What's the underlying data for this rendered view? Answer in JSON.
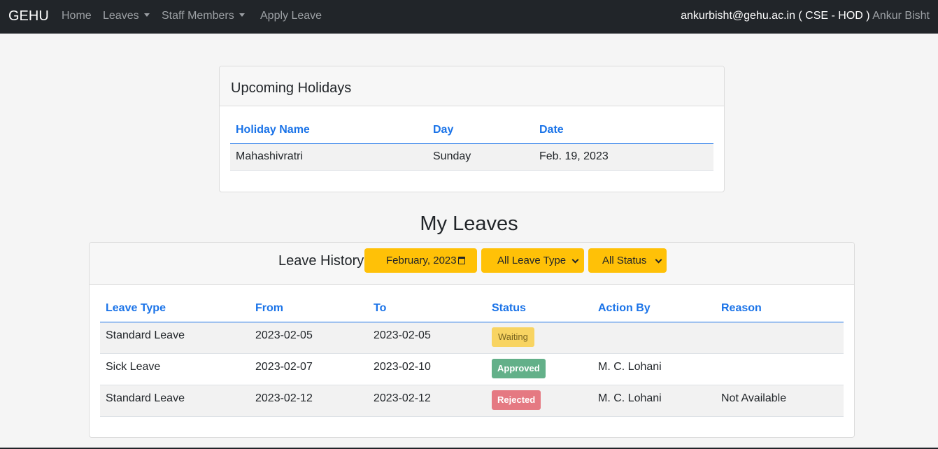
{
  "nav": {
    "brand": "GEHU",
    "items": [
      {
        "label": "Home"
      },
      {
        "label": "Leaves"
      },
      {
        "label": "Staff Members"
      },
      {
        "label": "Apply Leave"
      }
    ],
    "user_email_role": "ankurbisht@gehu.ac.in ( CSE - HOD )",
    "user_name": "Ankur Bisht"
  },
  "holidays": {
    "title": "Upcoming Holidays",
    "columns": [
      "Holiday Name",
      "Day",
      "Date"
    ],
    "rows": [
      {
        "name": "Mahashivratri",
        "day": "Sunday",
        "date": "Feb. 19, 2023"
      }
    ]
  },
  "leaves": {
    "section_title": "My Leaves",
    "header_label": "Leave History",
    "filters": {
      "month": "February, 2023",
      "type": "All Leave Type",
      "status": "All Status"
    },
    "columns": [
      "Leave Type",
      "From",
      "To",
      "Status",
      "Action By",
      "Reason"
    ],
    "rows": [
      {
        "type": "Standard Leave",
        "from": "2023-02-05",
        "to": "2023-02-05",
        "status": "Waiting",
        "action_by": "",
        "reason": ""
      },
      {
        "type": "Sick Leave",
        "from": "2023-02-07",
        "to": "2023-02-10",
        "status": "Approved",
        "action_by": "M. C. Lohani",
        "reason": ""
      },
      {
        "type": "Standard Leave",
        "from": "2023-02-12",
        "to": "2023-02-12",
        "status": "Rejected",
        "action_by": "M. C. Lohani",
        "reason": "Not Available"
      }
    ]
  },
  "colors": {
    "navbar": "#212529",
    "accent_blue": "#1a73e8",
    "filter_yellow": "#ffc107",
    "waiting": "#f8d462",
    "approved": "#63b089",
    "rejected": "#e57982"
  }
}
